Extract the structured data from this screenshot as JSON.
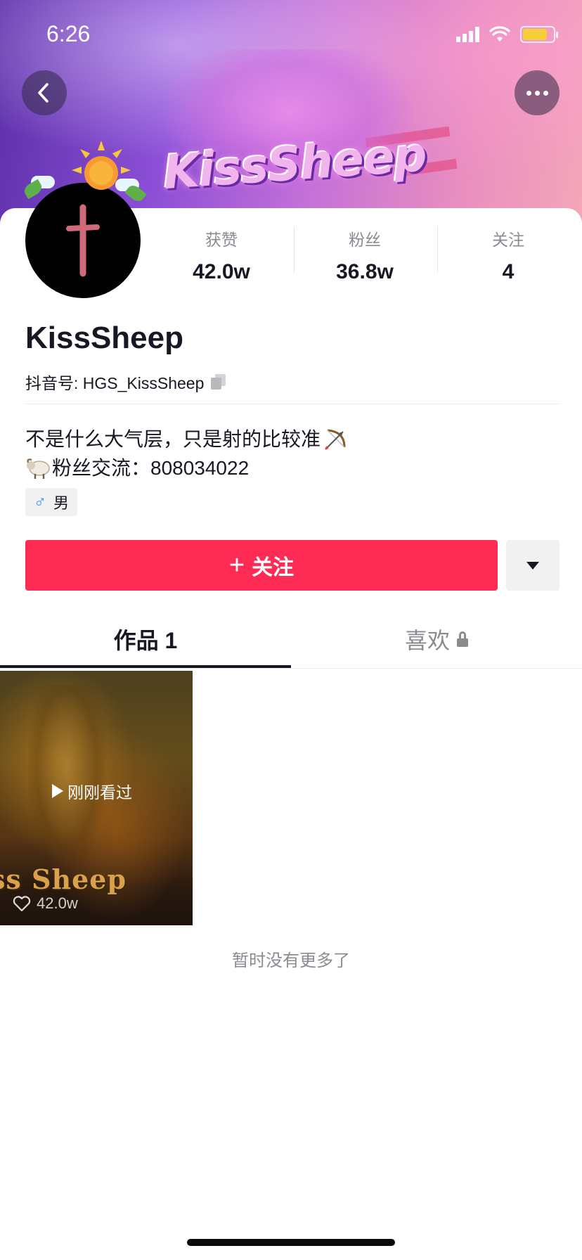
{
  "status_bar": {
    "time": "6:26",
    "battery_level": 0.8,
    "battery_color": "#f7cf3a"
  },
  "banner": {
    "logo_text": "KissSheep"
  },
  "nav": {
    "back_icon": "chevron-left-icon",
    "more_icon": "more-dots-icon"
  },
  "profile": {
    "avatar_icon": "cross-avatar",
    "stats": [
      {
        "label": "获赞",
        "value": "42.0w"
      },
      {
        "label": "粉丝",
        "value": "36.8w"
      },
      {
        "label": "关注",
        "value": "4"
      }
    ],
    "name": "KissSheep",
    "douyin_id": "抖音号: HGS_KissSheep",
    "bio_line1": "不是什么大气层，只是射的比较准",
    "bio_line2": "粉丝交流：808034022",
    "gender_symbol": "♂",
    "gender_label": "男"
  },
  "actions": {
    "follow_plus": "+",
    "follow_label": "关注",
    "follow_color": "#fe2c55"
  },
  "tabs": {
    "works_label": "作品 1",
    "likes_label": "喜欢"
  },
  "videos": [
    {
      "watched_label": "刚刚看过",
      "overlay_text": "ss Sheep",
      "likes": "42.0w"
    }
  ],
  "footer": {
    "no_more": "暂时没有更多了"
  }
}
